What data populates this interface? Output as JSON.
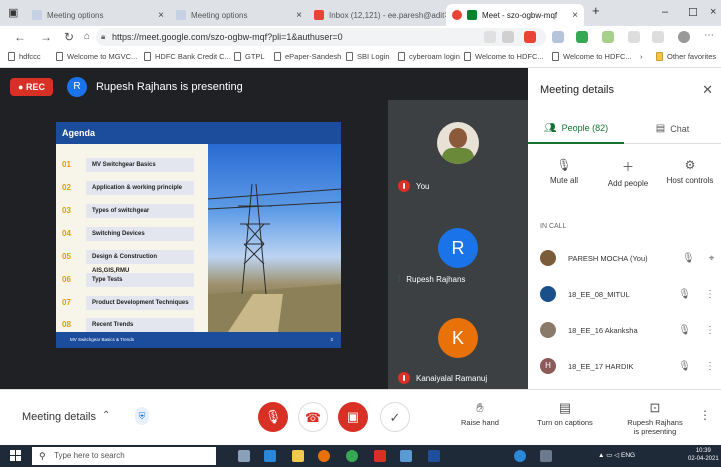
{
  "browser": {
    "tabs": [
      {
        "title": "Meeting options",
        "active": false
      },
      {
        "title": "Meeting options",
        "active": false
      },
      {
        "title": "Inbox (12,121) - ee.paresh@adit",
        "active": false
      },
      {
        "title": "Meet - szo-ogbw-mqf",
        "active": true
      }
    ],
    "new_tab": "+",
    "url": "https://meet.google.com/szo-ogbw-mqf?pli=1&authuser=0",
    "bookmarks": [
      "hdfccc",
      "Welcome to MGVC...",
      "HDFC Bank Credit C...",
      "GTPL",
      "ePaper-Sandesh",
      "SBI Login",
      "cyberoam login",
      "Welcome to HDFC...",
      "Welcome to HDFC..."
    ],
    "other_favorites": "Other favorites"
  },
  "meet": {
    "rec_label": "REC",
    "presenter_initial": "R",
    "presenting_text": "Rupesh Rajhans is presenting",
    "slide": {
      "title": "Agenda",
      "items": [
        {
          "num": "01",
          "label": "MV Switchgear Basics"
        },
        {
          "num": "02",
          "label": "Application & working principle"
        },
        {
          "num": "03",
          "label": "Types of switchgear"
        },
        {
          "num": "04",
          "label": "Switching Devices"
        },
        {
          "num": "05",
          "label": "Design & Construction AIS,GIS,RMU"
        },
        {
          "num": "06",
          "label": "Type Tests"
        },
        {
          "num": "07",
          "label": "Product Development Techniques"
        },
        {
          "num": "08",
          "label": "Recent Trends"
        }
      ],
      "footer": "MV Switchgear Basics & Trends",
      "page_num": "2"
    },
    "tiles": [
      {
        "name": "You"
      },
      {
        "name": "Rupesh Rajhans",
        "initial": "R",
        "color": "#1a73e8"
      },
      {
        "name": "Kanaiyalal Ramanuj",
        "initial": "K",
        "color": "#e8710a"
      }
    ]
  },
  "panel": {
    "title": "Meeting details",
    "tab_people": "People (82)",
    "tab_chat": "Chat",
    "actions": [
      "Mute all",
      "Add people",
      "Host controls"
    ],
    "in_call_label": "IN CALL",
    "participants": [
      {
        "name": "PARESH MOCHA (You)",
        "initial": "",
        "color": "#7a5c3a"
      },
      {
        "name": "18_EE_08_MITUL",
        "initial": "",
        "color": "#1a4f8a"
      },
      {
        "name": "18_EE_16 Akanksha",
        "initial": "",
        "color": "#8a7a6a"
      },
      {
        "name": "18_EE_17 HARDIK",
        "initial": "H",
        "color": "#8d5a5a"
      }
    ]
  },
  "bottombar": {
    "meeting_details": "Meeting details",
    "raise_hand": "Raise hand",
    "captions": "Turn on captions",
    "presenting_line1": "Rupesh Rajhans",
    "presenting_line2": "is presenting"
  },
  "taskbar": {
    "search_placeholder": "Type here to search",
    "lang": "ENG",
    "time": "10:39",
    "date": "02-04-2021"
  },
  "colors": {
    "rec_red": "#d93025",
    "meet_dark": "#202124",
    "people_green": "#137333",
    "slide_blue": "#1b4d9c"
  }
}
